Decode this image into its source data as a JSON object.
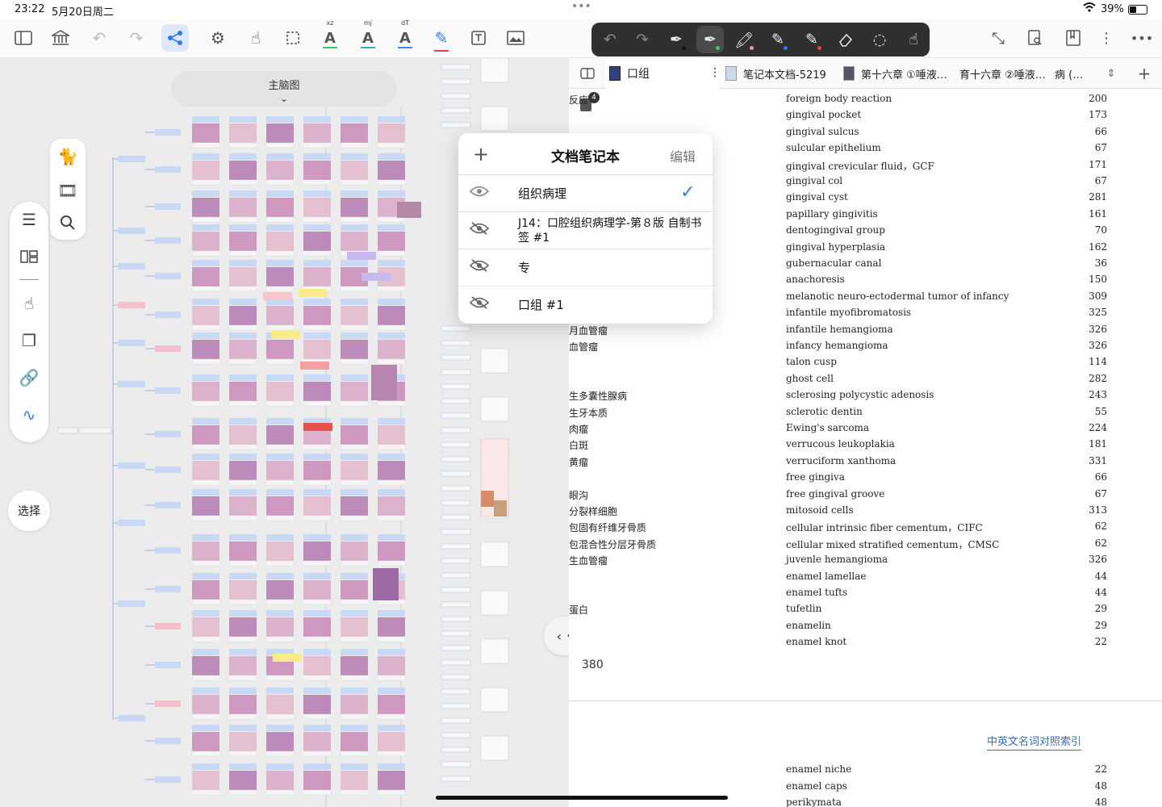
{
  "status_bar": {
    "time": "23:22",
    "date": "5月20日周二",
    "battery": "39%"
  },
  "toolbar": {
    "superscripts": {
      "xz": "xz",
      "mj": "mj",
      "dT": "dT"
    },
    "colors": {
      "accent": "#2f7bf6",
      "highlight_green": "#3ec46d",
      "highlight_teal": "#2bb6a8",
      "highlight_blue": "#3d8bf0",
      "pen_red": "#e64545"
    }
  },
  "canvas": {
    "map_title": "主脑图",
    "select_button": "选择",
    "left_tools": [
      "cat-icon",
      "film-icon",
      "search-icon",
      "list-icon",
      "layout-icon",
      "hand-icon",
      "copy-icon",
      "link-icon",
      "squiggle-icon"
    ]
  },
  "tabs": [
    {
      "label": "口组",
      "active": true
    },
    {
      "label": "笔记本文档-5219"
    },
    {
      "label": "第十六章 ①唾液…"
    },
    {
      "label": "育十六章 ②唾液…"
    },
    {
      "label": "病 (…"
    }
  ],
  "page_badge": "4",
  "popover": {
    "title": "文档笔记本",
    "edit": "编辑",
    "add": "+",
    "items": [
      {
        "name": "组织病理",
        "visible": true,
        "checked": true
      },
      {
        "name": "J14：口腔组织病理学-第８版 自制书签 #1",
        "visible": false,
        "checked": false
      },
      {
        "name": "专",
        "visible": false,
        "checked": false
      },
      {
        "name": "口组 #1",
        "visible": false,
        "checked": false
      }
    ]
  },
  "index_rows": [
    {
      "cn": "反应",
      "en": "foreign body reaction",
      "page": "200"
    },
    {
      "cn": "",
      "en": "gingival pocket",
      "page": "173"
    },
    {
      "cn": "",
      "en": "gingival sulcus",
      "page": "66"
    },
    {
      "cn": "",
      "en": "sulcular epithelium",
      "page": "67"
    },
    {
      "cn": "",
      "en": "gingival crevicular fluid，GCF",
      "page": "171"
    },
    {
      "cn": "",
      "en": "gingival col",
      "page": "67"
    },
    {
      "cn": "",
      "en": "gingival cyst",
      "page": "281"
    },
    {
      "cn": "",
      "en": "papillary gingivitis",
      "page": "161"
    },
    {
      "cn": "",
      "en": "dentogingival group",
      "page": "70"
    },
    {
      "cn": "",
      "en": "gingival hyperplasia",
      "page": "162"
    },
    {
      "cn": "",
      "en": "gubernacular canal",
      "page": "36"
    },
    {
      "cn": "",
      "en": "anachoresis",
      "page": "150"
    },
    {
      "cn": "",
      "en": "melanotic neuro-ectodermal tumor of infancy",
      "page": "309"
    },
    {
      "cn": "",
      "en": "infantile myofibromatosis",
      "page": "325"
    },
    {
      "cn": "月血管瘤",
      "en": "infantile hemangioma",
      "page": "326"
    },
    {
      "cn": "血管瘤",
      "en": "infancy hemangioma",
      "page": "326"
    },
    {
      "cn": "",
      "en": "talon cusp",
      "page": "114"
    },
    {
      "cn": "",
      "en": "ghost cell",
      "page": "282"
    },
    {
      "cn": "生多囊性腺病",
      "en": "sclerosing polycystic adenosis",
      "page": "243"
    },
    {
      "cn": "生牙本质",
      "en": "sclerotic dentin",
      "page": "55"
    },
    {
      "cn": "肉瘤",
      "en": "Ewing's sarcoma",
      "page": "224"
    },
    {
      "cn": "白斑",
      "en": "verrucous leukoplakia",
      "page": "181"
    },
    {
      "cn": "黄瘤",
      "en": "verruciform xanthoma",
      "page": "331"
    },
    {
      "cn": "",
      "en": "free gingiva",
      "page": "66"
    },
    {
      "cn": "眼沟",
      "en": "free gingival groove",
      "page": "67"
    },
    {
      "cn": "分裂样细胞",
      "en": "mitosoid cells",
      "page": "313"
    },
    {
      "cn": "包固有纤维牙骨质",
      "en": "cellular intrinsic fiber cementum，CIFC",
      "page": "62"
    },
    {
      "cn": "包混合性分层牙骨质",
      "en": "cellular mixed stratified cementum，CMSC",
      "page": "62"
    },
    {
      "cn": "生血管瘤",
      "en": "juvenle hemangioma",
      "page": "326"
    },
    {
      "cn": "",
      "en": "enamel lamellae",
      "page": "44"
    },
    {
      "cn": "",
      "en": "enamel tufts",
      "page": "44"
    },
    {
      "cn": "蛋白",
      "en": "tufetlin",
      "page": "29"
    },
    {
      "cn": "",
      "en": "enamelin",
      "page": "29"
    },
    {
      "cn": "",
      "en": "enamel knot",
      "page": "22"
    }
  ],
  "page_number": "380",
  "section_header": "中英文名词对照索引",
  "next_rows": [
    {
      "cn": "",
      "en": "enamel niche",
      "page": "22"
    },
    {
      "cn": "",
      "en": "enamel caps",
      "page": "48"
    },
    {
      "cn": "",
      "en": "perikymata",
      "page": "48"
    }
  ]
}
